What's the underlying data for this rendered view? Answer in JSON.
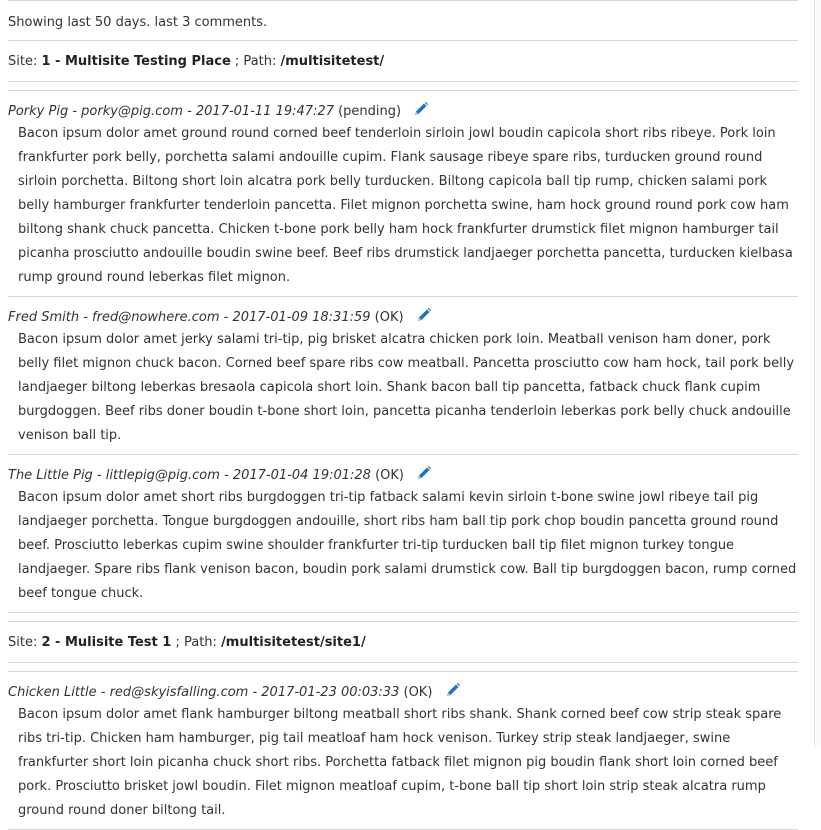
{
  "summary": "Showing last 50 days. last 3 comments.",
  "sites": [
    {
      "label": "Site:",
      "name": "1 - Multisite Testing Place",
      "path_label": "; Path:",
      "path": "/multisitetest/",
      "comments": [
        {
          "author": "Porky Pig - porky@pig.com - 2017-01-11 19:47:27",
          "status": "(pending)",
          "text": "Bacon ipsum dolor amet ground round corned beef tenderloin sirloin jowl boudin capicola short ribs ribeye. Pork loin frankfurter pork belly, porchetta salami andouille cupim. Flank sausage ribeye spare ribs, turducken ground round sirloin porchetta. Biltong short loin alcatra pork belly turducken. Biltong capicola ball tip rump, chicken salami pork belly hamburger frankfurter tenderloin pancetta. Filet mignon porchetta swine, ham hock ground round pork cow ham biltong shank chuck pancetta. Chicken t-bone pork belly ham hock frankfurter drumstick filet mignon hamburger tail picanha prosciutto andouille boudin swine beef. Beef ribs drumstick landjaeger porchetta pancetta, turducken kielbasa rump ground round leberkas filet mignon."
        },
        {
          "author": "Fred Smith - fred@nowhere.com - 2017-01-09 18:31:59",
          "status": "(OK)",
          "text": "Bacon ipsum dolor amet jerky salami tri-tip, pig brisket alcatra chicken pork loin. Meatball venison ham doner, pork belly filet mignon chuck bacon. Corned beef spare ribs cow meatball. Pancetta prosciutto cow ham hock, tail pork belly landjaeger biltong leberkas bresaola capicola short loin. Shank bacon ball tip pancetta, fatback chuck flank cupim burgdoggen. Beef ribs doner boudin t-bone short loin, pancetta picanha tenderloin leberkas pork belly chuck andouille venison ball tip."
        },
        {
          "author": "The Little Pig - littlepig@pig.com - 2017-01-04 19:01:28",
          "status": "(OK)",
          "text": "Bacon ipsum dolor amet short ribs burgdoggen tri-tip fatback salami kevin sirloin t-bone swine jowl ribeye tail pig landjaeger porchetta. Tongue burgdoggen andouille, short ribs ham ball tip pork chop boudin pancetta ground round beef. Prosciutto leberkas cupim swine shoulder frankfurter tri-tip turducken ball tip filet mignon turkey tongue landjaeger. Spare ribs flank venison bacon, boudin pork salami drumstick cow. Ball tip burgdoggen bacon, rump corned beef tongue chuck."
        }
      ]
    },
    {
      "label": "Site:",
      "name": "2 - Mulisite Test 1",
      "path_label": "; Path:",
      "path": "/multisitetest/site1/",
      "comments": [
        {
          "author": "Chicken Little - red@skyisfalling.com - 2017-01-23 00:03:33",
          "status": "(OK)",
          "text": "Bacon ipsum dolor amet flank hamburger biltong meatball short ribs shank. Shank corned beef cow strip steak spare ribs tri-tip. Chicken ham hamburger, pig tail meatloaf ham hock venison. Turkey strip steak landjaeger, swine frankfurter short loin picanha chuck short ribs. Porchetta fatback filet mignon pig boudin flank short loin corned beef pork. Prosciutto brisket jowl boudin. Filet mignon meatloaf cupim, t-bone ball tip short loin strip steak alcatra rump ground round doner biltong tail."
        }
      ]
    }
  ],
  "colors": {
    "edit_icon": "#1e73be",
    "rule": "#d6d6d6"
  },
  "icons": {
    "edit": "pencil-edit-icon"
  }
}
